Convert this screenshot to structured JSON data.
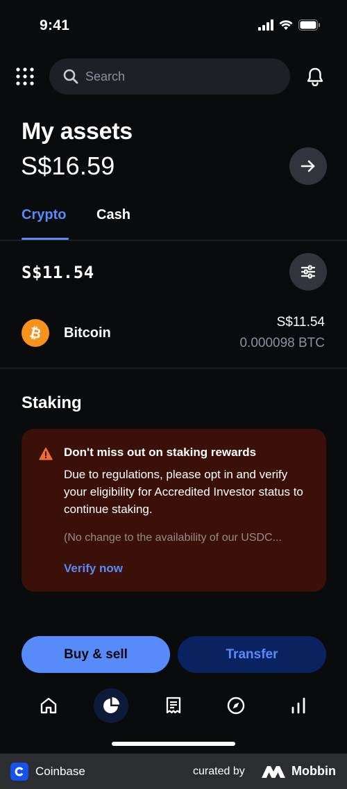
{
  "status_bar": {
    "time": "9:41"
  },
  "search": {
    "placeholder": "Search"
  },
  "assets": {
    "title": "My assets",
    "total": "S$16.59"
  },
  "tabs": [
    {
      "label": "Crypto",
      "active": true
    },
    {
      "label": "Cash",
      "active": false
    }
  ],
  "crypto": {
    "total": "S$11.54",
    "holdings": [
      {
        "name": "Bitcoin",
        "icon": "bitcoin-icon",
        "fiat_value": "S$11.54",
        "amount": "0.000098 BTC"
      }
    ]
  },
  "staking": {
    "title": "Staking",
    "alert": {
      "title": "Don't miss out on staking rewards",
      "body": "Due to regulations, please opt in and verify your eligibility for Accredited Investor status to continue staking.",
      "note": "(No change to the availability of our USDC...",
      "link": "Verify now"
    }
  },
  "actions": {
    "buy_sell": "Buy & sell",
    "transfer": "Transfer"
  },
  "bottom_nav": [
    {
      "icon": "home-icon",
      "active": false
    },
    {
      "icon": "portfolio-pie-icon",
      "active": true
    },
    {
      "icon": "receipt-icon",
      "active": false
    },
    {
      "icon": "compass-icon",
      "active": false
    },
    {
      "icon": "bar-chart-icon",
      "active": false
    }
  ],
  "footer": {
    "app_name": "Coinbase",
    "curated_by": "curated by",
    "brand": "Mobbin"
  },
  "colors": {
    "background": "#0a0b0d",
    "accent": "#578bfa",
    "bitcoin": "#f7931a",
    "alert_bg": "#3a1008",
    "warning": "#f26b3a"
  }
}
